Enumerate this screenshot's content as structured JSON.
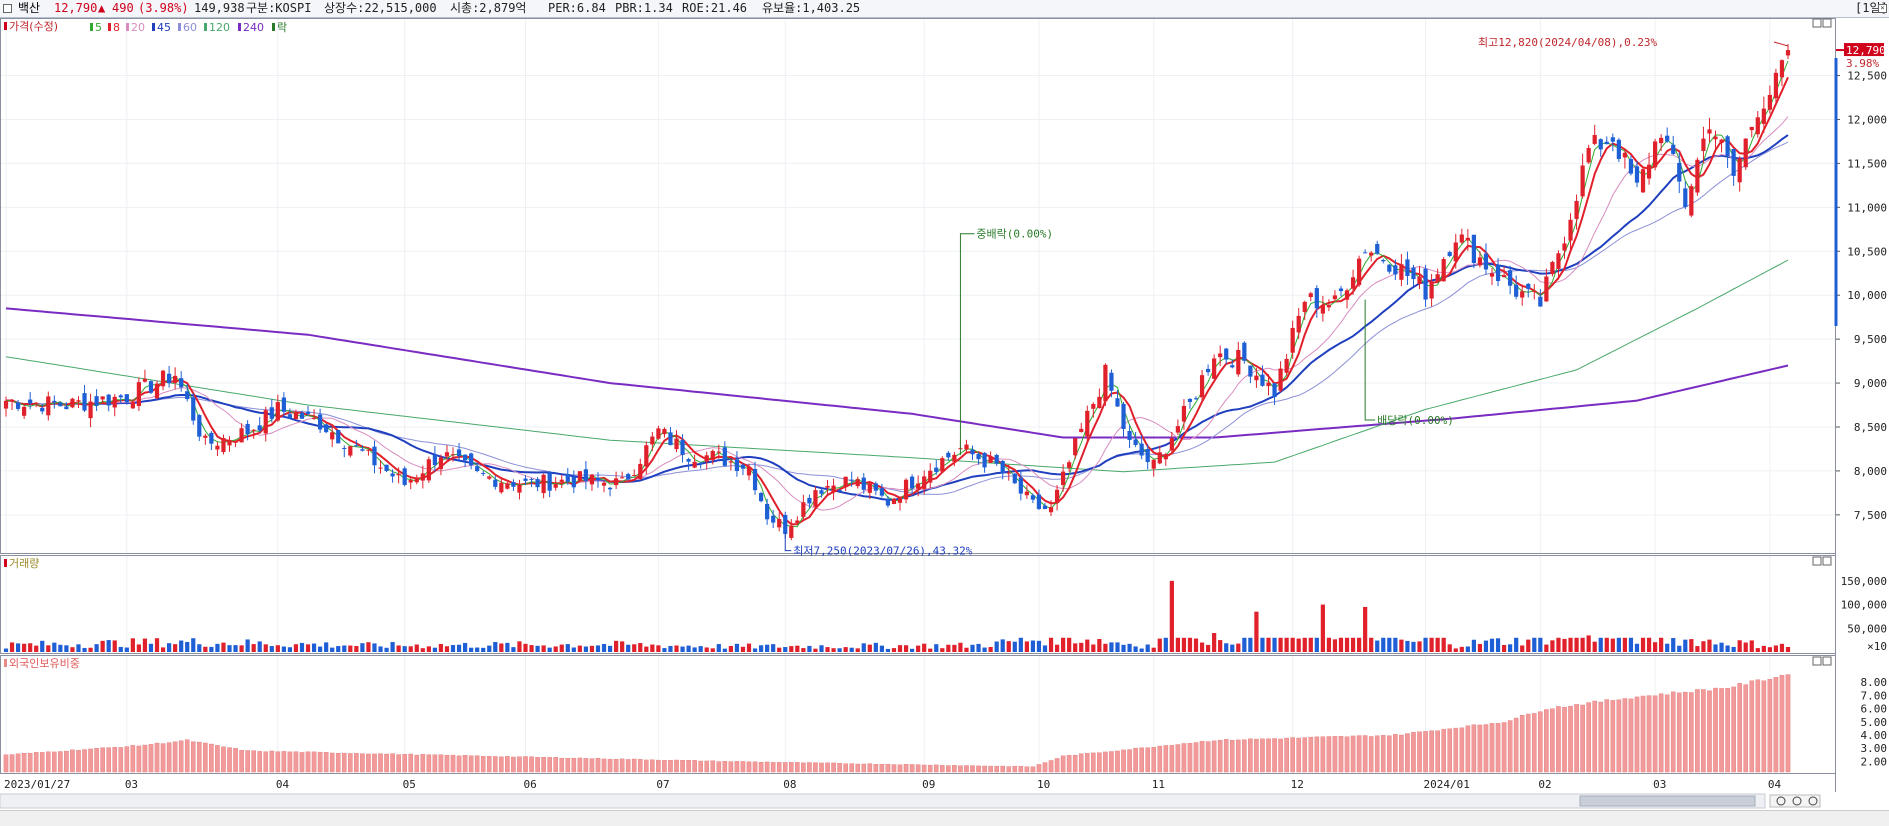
{
  "window": {
    "name": "백산",
    "price": "12,790",
    "change_arrow": "▲",
    "change": "490",
    "change_pct": "(3.98%)",
    "volume": "149,938",
    "market": "구분:KOSPI",
    "shares": "상장수:22,515,000",
    "mktcap": "시총:2,879억",
    "per": "PER:6.84",
    "pbr": "PBR:1.34",
    "roe": "ROE:21.46",
    "foreign": "유보율:1,403.25",
    "period": "[1일]"
  },
  "legend": {
    "main_label": "가격(수정)",
    "ma": [
      {
        "label": "5",
        "color": "#2eaa2e"
      },
      {
        "label": "8",
        "color": "#e0202a"
      },
      {
        "label": "20",
        "color": "#d98cc0"
      },
      {
        "label": "45",
        "color": "#1f3fbf"
      },
      {
        "label": "60",
        "color": "#8b8fd6"
      },
      {
        "label": "120",
        "color": "#49a86b"
      },
      {
        "label": "240",
        "color": "#7a2bc2"
      }
    ],
    "rak_label": "락",
    "volume_label": "거래량",
    "foreign_label": "외국인보유비중"
  },
  "annotations": {
    "high": "최고12,820(2024/04/08),0.23%",
    "low": "최저7,250(2023/07/26),43.32%",
    "mid_div": "중배락(0.00%)",
    "div": "배당락(0.00%)",
    "last_price": "12,790",
    "last_pct": "3.98%"
  },
  "chart_data": {
    "type": "candlestick",
    "price_ticks": [
      12500,
      12000,
      11500,
      11000,
      10500,
      10000,
      9500,
      9000,
      8500,
      8000,
      7500
    ],
    "price_tick_labels": [
      "12,500",
      "12,000",
      "11,500",
      "11,000",
      "10,500",
      "10,000",
      "9,500",
      "9,000",
      "8,500",
      "8,000",
      "7,500"
    ],
    "price_range": [
      7100,
      12950
    ],
    "volume_ticks": [
      150000,
      100000,
      50000
    ],
    "volume_tick_labels": [
      "150,000",
      "100,000",
      "50,000"
    ],
    "volume_unit": "×10",
    "volume_range": [
      0,
      175000
    ],
    "foreign_ticks": [
      8,
      7,
      6,
      5,
      4,
      3,
      2
    ],
    "foreign_tick_labels": [
      "8.00",
      "7.00",
      "6.00",
      "5.00",
      "4.00",
      "3.00",
      "2.00"
    ],
    "foreign_range": [
      1.2,
      9.0
    ],
    "x_labels": [
      "2023/01/27",
      "03",
      "04",
      "05",
      "06",
      "07",
      "08",
      "09",
      "10",
      "11",
      "12",
      "2024/01",
      "02",
      "03",
      "04"
    ],
    "x_label_days": [
      0,
      20,
      45,
      66,
      86,
      108,
      129,
      152,
      171,
      190,
      213,
      235,
      254,
      273,
      292
    ],
    "price_waypoints": [
      [
        0,
        8800
      ],
      [
        10,
        8750
      ],
      [
        20,
        8850
      ],
      [
        28,
        9100
      ],
      [
        33,
        8300
      ],
      [
        40,
        8450
      ],
      [
        45,
        8700
      ],
      [
        52,
        8550
      ],
      [
        60,
        8150
      ],
      [
        66,
        7850
      ],
      [
        72,
        8200
      ],
      [
        78,
        7950
      ],
      [
        86,
        7850
      ],
      [
        95,
        7900
      ],
      [
        102,
        7850
      ],
      [
        108,
        8450
      ],
      [
        113,
        8200
      ],
      [
        118,
        8150
      ],
      [
        123,
        8050
      ],
      [
        126,
        7500
      ],
      [
        129,
        7350
      ],
      [
        134,
        7800
      ],
      [
        140,
        7900
      ],
      [
        146,
        7650
      ],
      [
        152,
        8000
      ],
      [
        158,
        8250
      ],
      [
        164,
        8050
      ],
      [
        170,
        7600
      ],
      [
        173,
        7550
      ],
      [
        178,
        8450
      ],
      [
        182,
        9100
      ],
      [
        186,
        8300
      ],
      [
        190,
        8050
      ],
      [
        196,
        8750
      ],
      [
        200,
        9350
      ],
      [
        205,
        9250
      ],
      [
        210,
        8900
      ],
      [
        215,
        9950
      ],
      [
        220,
        9900
      ],
      [
        225,
        10550
      ],
      [
        230,
        10350
      ],
      [
        235,
        10050
      ],
      [
        240,
        10700
      ],
      [
        245,
        10350
      ],
      [
        250,
        10050
      ],
      [
        254,
        9900
      ],
      [
        258,
        10700
      ],
      [
        262,
        11650
      ],
      [
        266,
        11800
      ],
      [
        270,
        11200
      ],
      [
        274,
        11900
      ],
      [
        278,
        11050
      ],
      [
        282,
        12000
      ],
      [
        286,
        11350
      ],
      [
        290,
        12150
      ],
      [
        293,
        12400
      ],
      [
        295,
        12790
      ]
    ],
    "ma240_waypoints": [
      [
        0,
        9850
      ],
      [
        50,
        9550
      ],
      [
        100,
        9000
      ],
      [
        150,
        8650
      ],
      [
        175,
        8380
      ],
      [
        200,
        8380
      ],
      [
        240,
        8600
      ],
      [
        270,
        8800
      ],
      [
        295,
        9200
      ]
    ],
    "ma120_waypoints": [
      [
        0,
        9300
      ],
      [
        50,
        8750
      ],
      [
        100,
        8350
      ],
      [
        150,
        8150
      ],
      [
        185,
        7990
      ],
      [
        210,
        8100
      ],
      [
        235,
        8700
      ],
      [
        260,
        9150
      ],
      [
        280,
        9850
      ],
      [
        295,
        10400
      ]
    ],
    "volume_waypoints": [
      [
        0,
        14000
      ],
      [
        30,
        20000
      ],
      [
        60,
        13000
      ],
      [
        100,
        15000
      ],
      [
        120,
        11000
      ],
      [
        160,
        13000
      ],
      [
        175,
        30000
      ],
      [
        190,
        12000
      ],
      [
        193,
        150000
      ],
      [
        200,
        40000
      ],
      [
        207,
        85000
      ],
      [
        218,
        100000
      ],
      [
        225,
        95000
      ],
      [
        240,
        15000
      ],
      [
        262,
        35000
      ],
      [
        295,
        12000
      ]
    ],
    "foreign_waypoints": [
      [
        0,
        2.5
      ],
      [
        22,
        3.2
      ],
      [
        30,
        3.6
      ],
      [
        40,
        2.8
      ],
      [
        80,
        2.4
      ],
      [
        120,
        2.0
      ],
      [
        170,
        1.6
      ],
      [
        175,
        2.4
      ],
      [
        200,
        3.6
      ],
      [
        230,
        4.0
      ],
      [
        248,
        5.0
      ],
      [
        255,
        6.0
      ],
      [
        270,
        6.9
      ],
      [
        285,
        7.6
      ],
      [
        295,
        8.6
      ]
    ],
    "total_days": 296,
    "events": {
      "high_day": 295,
      "low_day": 129,
      "mid_div_day": 158,
      "div_day": 225
    }
  }
}
